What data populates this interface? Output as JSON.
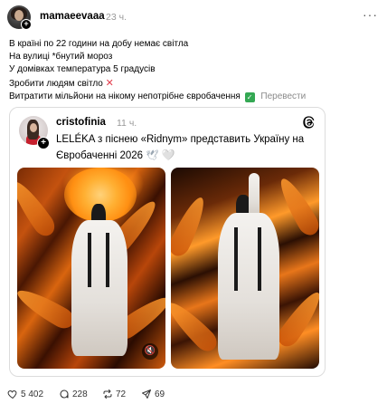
{
  "post": {
    "username": "mamaeevaaa",
    "time": "23 ч.",
    "more_icon": "more-horizontal-icon",
    "lines": [
      "В країні по 22 години на добу немає світла",
      "На вулиці *бнутий мороз",
      "У домівках температура 5 градусів",
      "Зробити людям світло",
      "Витратити мільйони на нікому непотрібне євробачення"
    ],
    "x_emoji": "✕",
    "check_emoji": "✓",
    "translate_label": "Перевести"
  },
  "quoted": {
    "username": "cristofinia",
    "time": "11 ч.",
    "text": "LELÉKA з піснею «Ridnym» представить Україну на Євробаченні 2026",
    "dove_emoji": "🕊",
    "heart_emoji": "🤍",
    "images": [
      "performance-photo-1",
      "performance-photo-2"
    ],
    "mute_icon": "mute-icon"
  },
  "footer": {
    "likes": "5 402",
    "comments": "228",
    "reposts": "72",
    "shares": "69"
  },
  "colors": {
    "accent_red": "#e23b4b",
    "check_green": "#34a853",
    "muted_gray": "#999999"
  }
}
